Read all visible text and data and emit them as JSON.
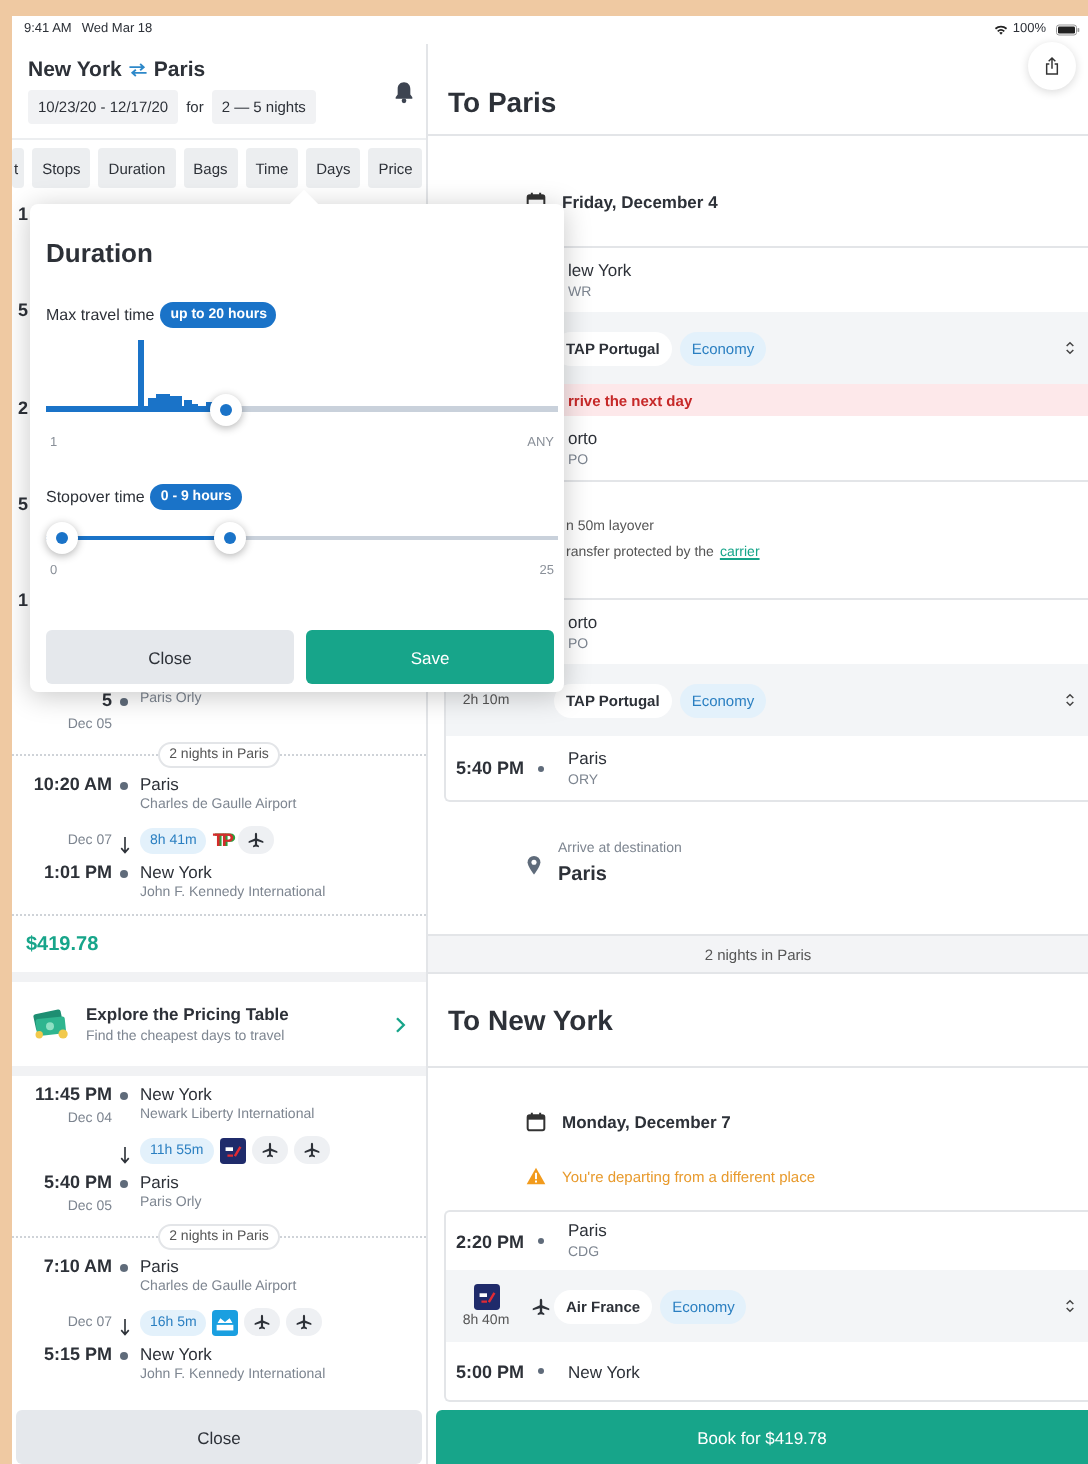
{
  "status_bar": {
    "time": "9:41 AM",
    "date": "Wed Mar 18",
    "battery": "100%"
  },
  "search": {
    "from": "New York",
    "to": "Paris",
    "dates": "10/23/20 - 12/17/20",
    "for_label": "for",
    "nights": "2 — 5 nights"
  },
  "filters": [
    "t",
    "Stops",
    "Duration",
    "Bags",
    "Time",
    "Days",
    "Price"
  ],
  "result_fragments": [
    "1",
    "5",
    "2",
    "5",
    "1"
  ],
  "results": [
    {
      "kind": "stop",
      "time": "5",
      "date": "Dec 05",
      "airport": "Paris Orly"
    },
    {
      "kind": "stay",
      "text": "2 nights in Paris"
    },
    {
      "kind": "stop",
      "time": "10:20 AM",
      "city": "Paris",
      "airport": "Charles de Gaulle Airport"
    },
    {
      "kind": "segment",
      "date": "Dec 07",
      "duration": "8h 41m",
      "carriers": [
        {
          "kind": "wordmark",
          "text": "TP"
        },
        {
          "kind": "plane"
        }
      ]
    },
    {
      "kind": "stop",
      "time": "1:01 PM",
      "city": "New York",
      "airport": "John F. Kennedy International"
    },
    {
      "kind": "price",
      "text": "$419.78"
    },
    {
      "kind": "promo",
      "title": "Explore the Pricing Table",
      "subtitle": "Find the cheapest days to travel"
    },
    {
      "kind": "stop",
      "time": "11:45 PM",
      "date": "Dec 04",
      "city": "New York",
      "airport": "Newark Liberty International"
    },
    {
      "kind": "segment",
      "duration": "11h 55m",
      "carriers": [
        {
          "kind": "af"
        },
        {
          "kind": "plane"
        },
        {
          "kind": "plane"
        }
      ]
    },
    {
      "kind": "stop",
      "time": "5:40 PM",
      "date": "Dec 05",
      "city": "Paris",
      "airport": "Paris Orly"
    },
    {
      "kind": "stay",
      "text": "2 nights in Paris"
    },
    {
      "kind": "stop",
      "time": "7:10 AM",
      "city": "Paris",
      "airport": "Charles de Gaulle Airport"
    },
    {
      "kind": "segment",
      "date": "Dec 07",
      "duration": "16h 5m",
      "carriers": [
        {
          "kind": "klm"
        },
        {
          "kind": "plane"
        },
        {
          "kind": "plane"
        }
      ]
    },
    {
      "kind": "stop",
      "time": "5:15 PM",
      "city": "New York",
      "airport": "John F. Kennedy International"
    }
  ],
  "close_button": "Close",
  "popover": {
    "title": "Duration",
    "max_travel": {
      "label": "Max travel time",
      "value": "up to 20 hours",
      "level": 0.35,
      "min_label": "1",
      "max_label": "ANY"
    },
    "stopover": {
      "label": "Stopover time",
      "value": "0 - 9 hours",
      "thumbs": [
        {
          "level": 0
        },
        {
          "level": 0.36
        }
      ],
      "min_label": "0",
      "max_label": "25"
    },
    "buttons": [
      {
        "kind": "secondary",
        "label": "Close"
      },
      {
        "kind": "primary",
        "label": "Save"
      }
    ]
  },
  "trip": [
    {
      "kind": "header",
      "title": "To Paris"
    },
    {
      "kind": "date",
      "text": "Friday, December 4"
    },
    {
      "kind": "card",
      "rows": [
        {
          "kind": "stop",
          "city": "lew York",
          "code": "WR"
        },
        {
          "kind": "flight",
          "airline": "TAP Portugal",
          "cabin": "Economy"
        },
        {
          "kind": "alert",
          "text": "rrive the next day"
        },
        {
          "kind": "stop",
          "city": "orto",
          "code": "PO"
        }
      ]
    },
    {
      "kind": "layover",
      "title": "n 50m layover",
      "text": "ransfer protected by the",
      "link": "carrier"
    },
    {
      "kind": "card",
      "rows": [
        {
          "kind": "stop",
          "city": "orto",
          "code": "PO"
        },
        {
          "kind": "flight",
          "duration": "2h 10m",
          "airline": "TAP Portugal",
          "cabin": "Economy"
        },
        {
          "kind": "stop",
          "time": "5:40 PM",
          "city": "Paris",
          "code": "ORY"
        }
      ]
    },
    {
      "kind": "destination",
      "label": "Arrive at destination",
      "city": "Paris"
    },
    {
      "kind": "band",
      "text": "2 nights in Paris"
    },
    {
      "kind": "header",
      "title": "To New York"
    },
    {
      "kind": "date",
      "text": "Monday, December 7"
    },
    {
      "kind": "warning",
      "text": "You're departing from a different place"
    },
    {
      "kind": "card",
      "rows": [
        {
          "kind": "stop",
          "time": "2:20 PM",
          "city": "Paris",
          "code": "CDG"
        },
        {
          "kind": "flight",
          "logos": [
            {
              "kind": "af"
            }
          ],
          "duration": "8h 40m",
          "airline": "Air France",
          "cabin": "Economy"
        },
        {
          "kind": "stop",
          "time": "5:00 PM",
          "city": "New York"
        }
      ]
    }
  ],
  "book_button": "Book for $419.78"
}
